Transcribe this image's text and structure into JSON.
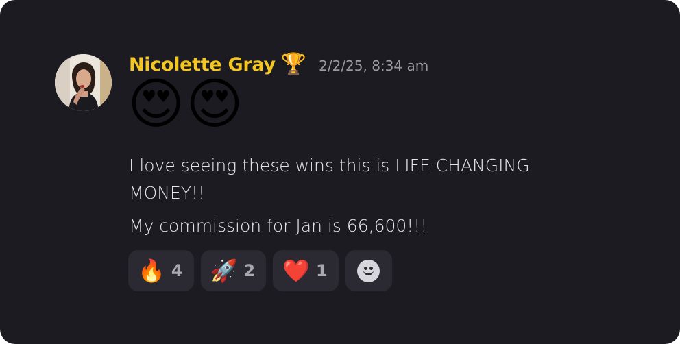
{
  "message": {
    "author": "Nicolette Gray",
    "author_badge_icon": "trophy-icon",
    "author_badge": "🏆",
    "timestamp": "2/2/25, 8:34 am",
    "big_emoji": "😍😍",
    "lines": [
      "I love seeing these wins this is LIFE CHANGING MONEY!!",
      "My commission for Jan is 66,600!!!"
    ],
    "colors": {
      "author": "#f3c623",
      "background": "#1c1b22",
      "reaction_bg": "#2b2a32"
    }
  },
  "reactions": [
    {
      "icon": "fire-icon",
      "emoji": "🔥",
      "count": "4"
    },
    {
      "icon": "rocket-icon",
      "emoji": "🚀",
      "count": "2"
    },
    {
      "icon": "heart-icon",
      "emoji": "❤️",
      "count": "1"
    }
  ],
  "add_reaction_icon": "smiley-add-reaction-icon"
}
